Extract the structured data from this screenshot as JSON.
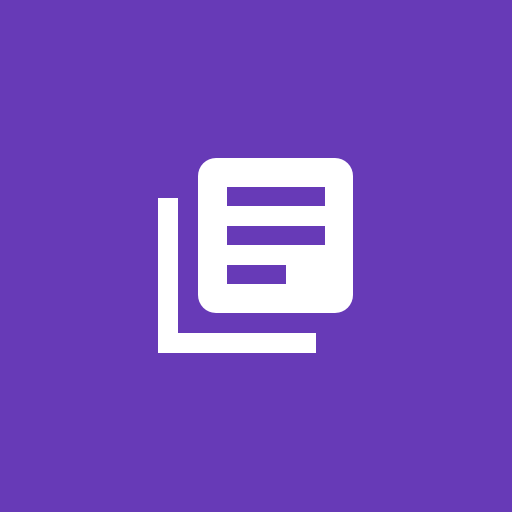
{
  "icon": {
    "name": "library-books-icon",
    "background_color": "#673ab7",
    "foreground_color": "#ffffff",
    "line_color": "#673ab7"
  }
}
